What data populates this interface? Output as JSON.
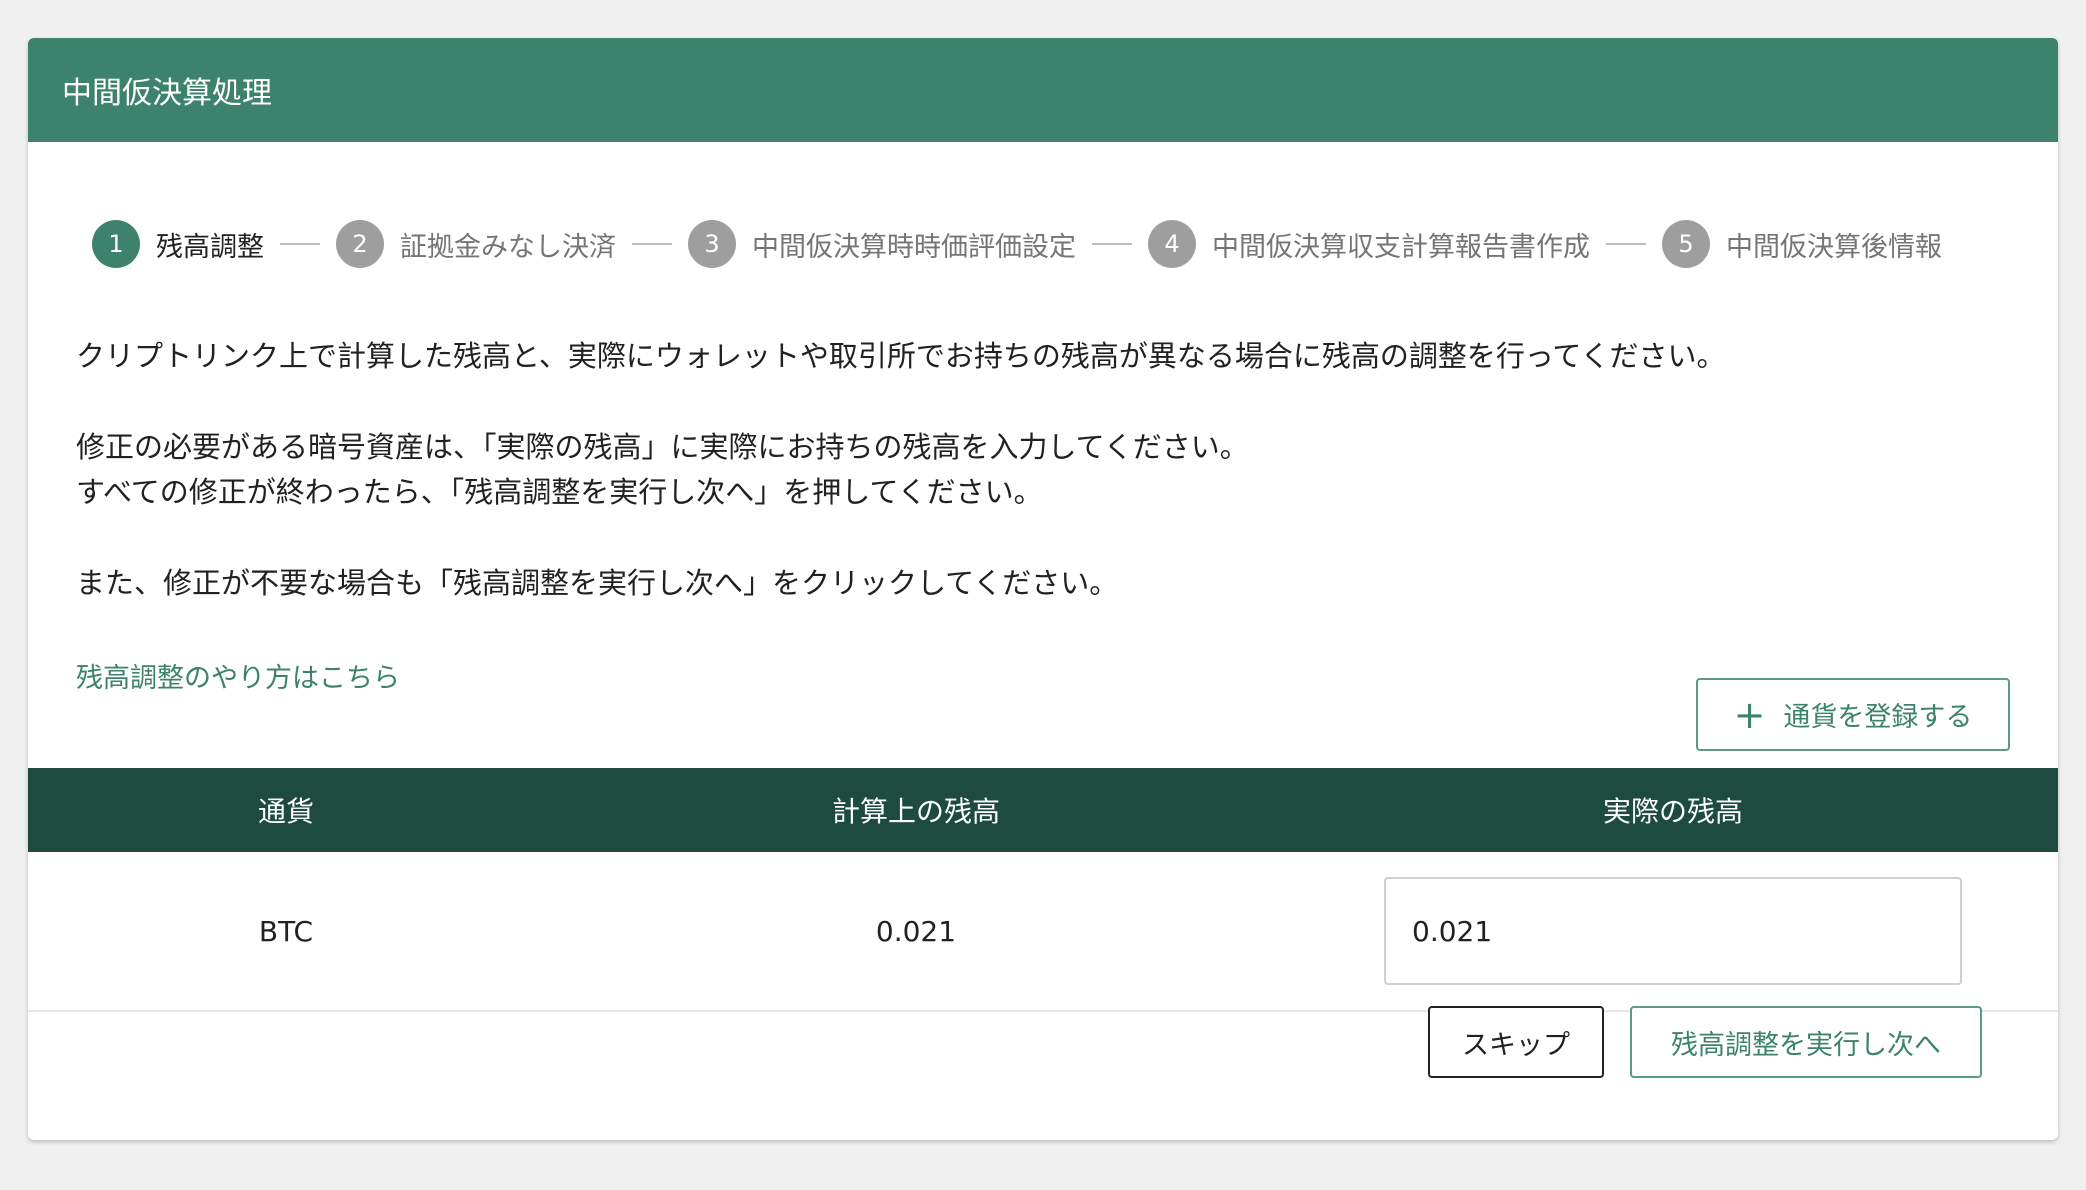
{
  "header": {
    "title": "中間仮決算処理"
  },
  "stepper": {
    "steps": [
      {
        "number": "1",
        "label": "残高調整"
      },
      {
        "number": "2",
        "label": "証拠金みなし決済"
      },
      {
        "number": "3",
        "label": "中間仮決算時時価評価設定"
      },
      {
        "number": "4",
        "label": "中間仮決算収支計算報告書作成"
      },
      {
        "number": "5",
        "label": "中間仮決算後情報"
      }
    ],
    "active_step": 1
  },
  "instructions": {
    "line1": "クリプトリンク上で計算した残高と、実際にウォレットや取引所でお持ちの残高が異なる場合に残高の調整を行ってください。",
    "line2": "修正の必要がある暗号資産は、「実際の残高」に実際にお持ちの残高を入力してください。",
    "line3": "すべての修正が終わったら、「残高調整を実行し次へ」を押してください。",
    "line4": "また、修正が不要な場合も「残高調整を実行し次へ」をクリックしてください。"
  },
  "help_link": "残高調整のやり方はこちら",
  "add_currency_button": {
    "icon": "plus-icon",
    "label": "通貨を登録する"
  },
  "table": {
    "columns": [
      "通貨",
      "計算上の残高",
      "実際の残高"
    ],
    "rows": [
      {
        "currency": "BTC",
        "calculated_balance": "0.021",
        "actual_balance": "0.021"
      }
    ]
  },
  "footer": {
    "skip_label": "スキップ",
    "next_label": "残高調整を実行し次へ"
  },
  "colors": {
    "primary": "#3c826c",
    "table_header": "#1e4b3f",
    "inactive_step": "#9e9e9e"
  }
}
